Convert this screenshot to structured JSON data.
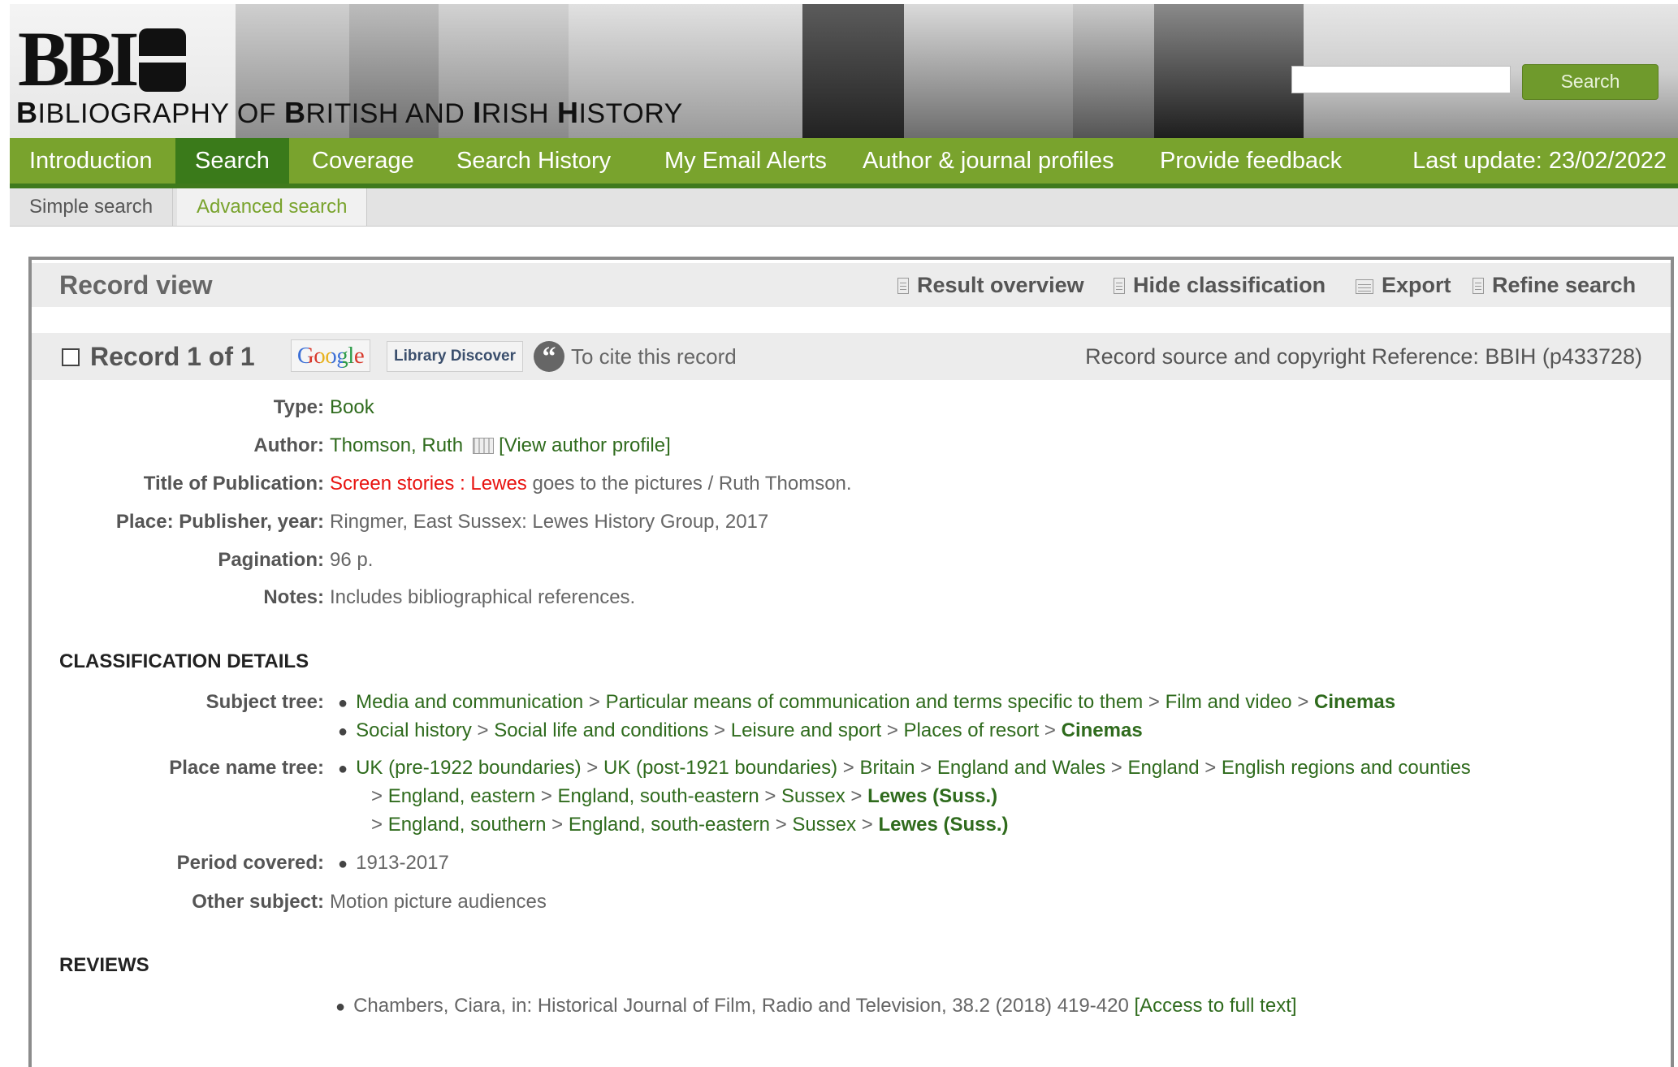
{
  "header": {
    "site_title_parts": [
      "B",
      "IBLIOGRAPHY OF ",
      "B",
      "RITISH AND ",
      "I",
      "RISH ",
      "H",
      "ISTORY"
    ],
    "search_button": "Search",
    "search_value": ""
  },
  "nav": {
    "items": [
      "Introduction",
      "Search",
      "Coverage",
      "Search History",
      "My Email Alerts",
      "Author & journal profiles",
      "Provide feedback"
    ],
    "active": "Search",
    "last_update": "Last update: 23/02/2022"
  },
  "subnav": {
    "simple": "Simple search",
    "advanced": "Advanced search"
  },
  "panel": {
    "title": "Record view",
    "tools": [
      "Result overview",
      "Hide classification",
      "Export",
      "Refine search"
    ]
  },
  "record": {
    "title": "Record 1 of 1",
    "google": "Google",
    "library_discover": "Library Discover",
    "cite": "To cite this record",
    "source": "Record source and copyright Reference: BBIH (p433728)"
  },
  "fields": {
    "type_label": "Type:",
    "type": "Book",
    "author_label": "Author:",
    "author": "Thomson, Ruth",
    "author_profile": "[View author profile]",
    "title_label": "Title of Publication:",
    "title_hl1": "Screen stories",
    "title_sep": " : ",
    "title_hl2": "Lewes",
    "title_rest": " goes to the pictures / Ruth Thomson.",
    "place_label": "Place: Publisher, year:",
    "place": "Ringmer, East Sussex: Lewes History Group, 2017",
    "pagination_label": "Pagination:",
    "pagination": "96 p.",
    "notes_label": "Notes:",
    "notes": "Includes bibliographical references."
  },
  "classification": {
    "heading": "CLASSIFICATION DETAILS",
    "subject_label": "Subject tree:",
    "subject_1": [
      "Media and communication",
      "Particular means of communication and terms specific to them",
      "Film and video"
    ],
    "subject_1_end": "Cinemas",
    "subject_2": [
      "Social history",
      "Social life and conditions",
      "Leisure and sport",
      "Places of resort"
    ],
    "subject_2_end": "Cinemas",
    "place_label": "Place name tree:",
    "place_1": [
      "UK (pre-1922 boundaries)",
      "UK (post-1921 boundaries)",
      "Britain",
      "England and Wales",
      "England",
      "English regions and counties"
    ],
    "place_2": [
      "England, eastern",
      "England, south-eastern",
      "Sussex"
    ],
    "place_2_end": "Lewes (Suss.)",
    "place_3": [
      "England, southern",
      "England, south-eastern",
      "Sussex"
    ],
    "place_3_end": "Lewes (Suss.)",
    "period_label": "Period covered:",
    "period": "1913-2017",
    "other_label": "Other subject:",
    "other": "Motion picture audiences"
  },
  "reviews": {
    "heading": "REVIEWS",
    "item": "Chambers, Ciara, in: Historical Journal of Film, Radio and Television, 38.2 (2018) 419-420 ",
    "link": "[Access to full text]"
  }
}
